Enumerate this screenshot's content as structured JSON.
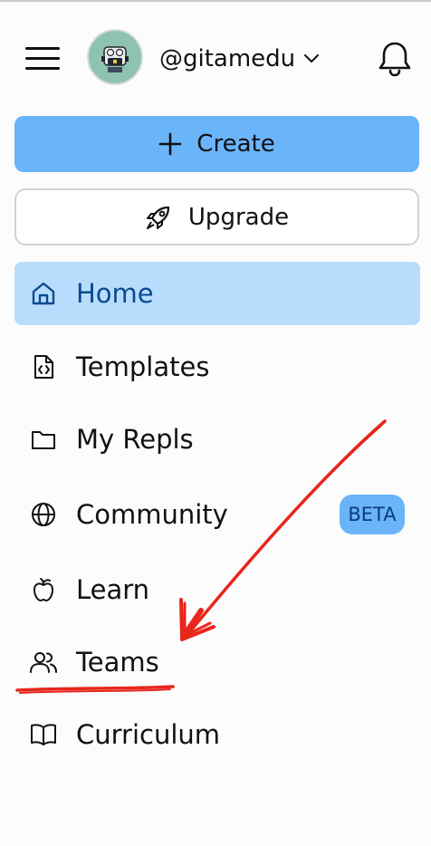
{
  "header": {
    "username": "@gitamedu"
  },
  "actions": {
    "create_label": "Create",
    "upgrade_label": "Upgrade"
  },
  "nav": {
    "items": [
      {
        "label": "Home",
        "icon": "home-icon",
        "active": true
      },
      {
        "label": "Templates",
        "icon": "file-code-icon"
      },
      {
        "label": "My Repls",
        "icon": "folder-icon"
      },
      {
        "label": "Community",
        "icon": "globe-icon",
        "badge": "BETA"
      },
      {
        "label": "Learn",
        "icon": "apple-icon"
      },
      {
        "label": "Teams",
        "icon": "users-icon"
      },
      {
        "label": "Curriculum",
        "icon": "book-icon"
      }
    ]
  },
  "colors": {
    "accent": "#6ab4f9",
    "active_bg": "#b8dcfc",
    "active_text": "#0b4a92",
    "annotation": "#e8261c"
  }
}
